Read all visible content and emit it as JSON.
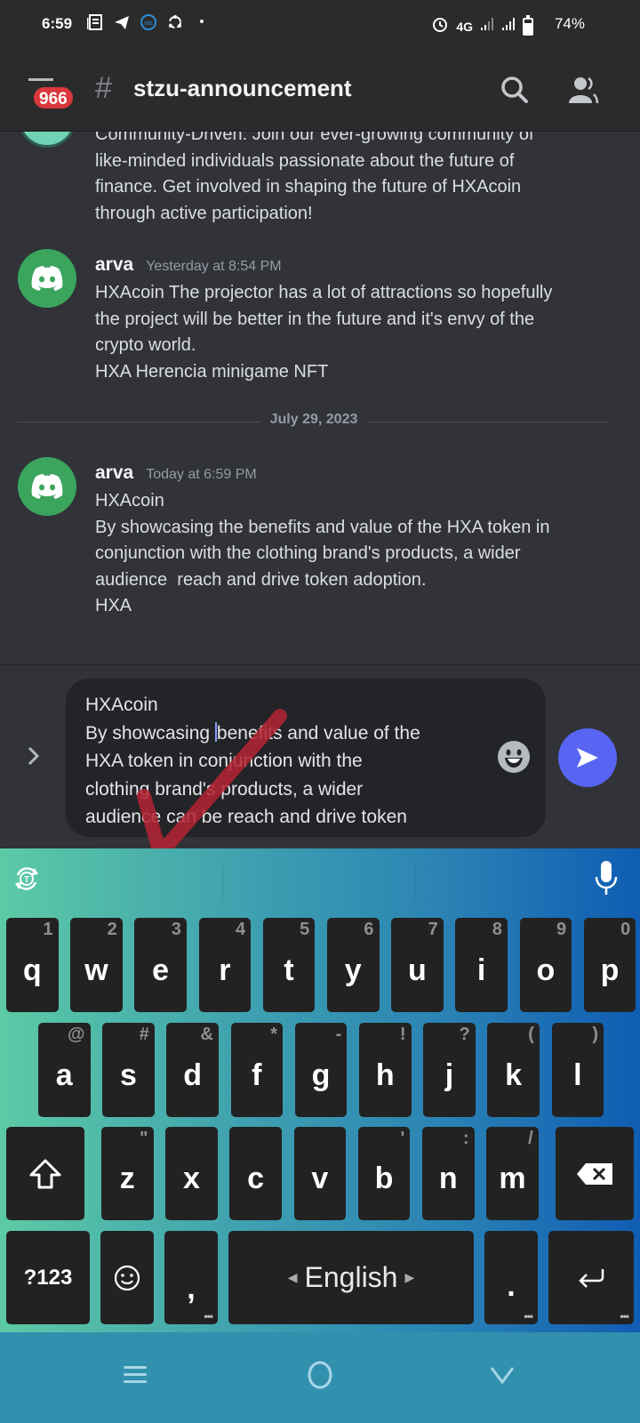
{
  "status_bar": {
    "time": "6:59",
    "left_icons": [
      "news-icon",
      "telegram-icon",
      "messenger-icon",
      "sync-icon",
      "dot-icon"
    ],
    "network": "4G",
    "battery_percent": "74%",
    "battery_level": 0.74
  },
  "header": {
    "unread_badge": "966",
    "channel_prefix": "#",
    "channel_name": "stzu-announcement"
  },
  "messages": [
    {
      "author": "",
      "timestamp": "",
      "avatar": "community-avatar",
      "lines": [
        "Community-Driven: Join our ever-growing community of",
        "like-minded individuals passionate about the future of",
        "finance. Get involved in shaping the future of HXAcoin",
        "through active participation!"
      ]
    },
    {
      "author": "arva",
      "timestamp": "Yesterday at 8:54 PM",
      "avatar": "discord-default-avatar",
      "lines": [
        "HXAcoin The projector has a lot of attractions so hopefully",
        "the project will be better in the future and it's envy of the",
        "crypto world.",
        "HXA Herencia minigame NFT"
      ]
    },
    {
      "author": "arva",
      "timestamp": "Today at 6:59 PM",
      "avatar": "discord-default-avatar",
      "lines": [
        "HXAcoin",
        "By showcasing the benefits and value of the HXA token in",
        "conjunction with the clothing brand's products, a wider",
        "audience  reach and drive token adoption.",
        "HXA"
      ]
    }
  ],
  "date_divider": "July 29, 2023",
  "composer": {
    "line1": "HXAcoin",
    "line2_before_caret": "By showcasing ",
    "line2_after_caret": "benefits and value of the",
    "line3": "HXA token in conjunction with the",
    "line4": "clothing brand's products, a wider",
    "line5": "audience can be reach and drive token"
  },
  "keyboard": {
    "row1": [
      {
        "key": "q",
        "hint": "1"
      },
      {
        "key": "w",
        "hint": "2"
      },
      {
        "key": "e",
        "hint": "3"
      },
      {
        "key": "r",
        "hint": "4"
      },
      {
        "key": "t",
        "hint": "5"
      },
      {
        "key": "y",
        "hint": "6"
      },
      {
        "key": "u",
        "hint": "7"
      },
      {
        "key": "i",
        "hint": "8"
      },
      {
        "key": "o",
        "hint": "9"
      },
      {
        "key": "p",
        "hint": "0"
      }
    ],
    "row2": [
      {
        "key": "a",
        "hint": "@"
      },
      {
        "key": "s",
        "hint": "#"
      },
      {
        "key": "d",
        "hint": "&"
      },
      {
        "key": "f",
        "hint": "*"
      },
      {
        "key": "g",
        "hint": "-"
      },
      {
        "key": "h",
        "hint": "!"
      },
      {
        "key": "j",
        "hint": "?"
      },
      {
        "key": "k",
        "hint": "("
      },
      {
        "key": "l",
        "hint": ")"
      }
    ],
    "row3": [
      {
        "key": "z",
        "hint": "\""
      },
      {
        "key": "x",
        "hint": ""
      },
      {
        "key": "c",
        "hint": ""
      },
      {
        "key": "v",
        "hint": ""
      },
      {
        "key": "b",
        "hint": "'"
      },
      {
        "key": "n",
        "hint": ":"
      },
      {
        "key": "m",
        "hint": "/"
      }
    ],
    "symbols_label": "?123",
    "comma": ",",
    "space_label": "English",
    "period": ".",
    "more_dots": "•••"
  },
  "colors": {
    "accent": "#5865f2",
    "badge": "#da373c",
    "avatar_green": "#3ba55d",
    "annotation_red": "#b52331"
  }
}
